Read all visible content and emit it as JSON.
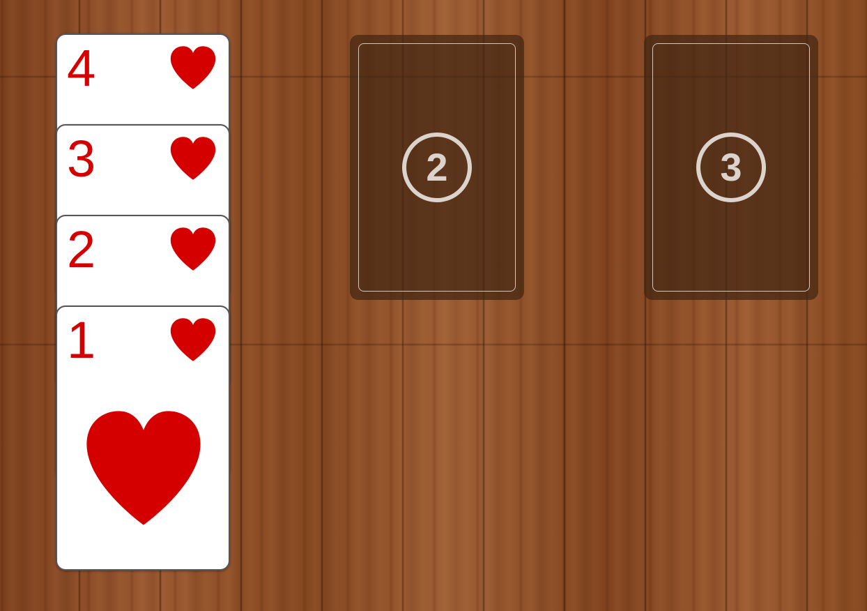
{
  "tableau": {
    "cards": [
      {
        "rank": "4",
        "suit": "hearts-icon"
      },
      {
        "rank": "3",
        "suit": "hearts-icon"
      },
      {
        "rank": "2",
        "suit": "hearts-icon"
      },
      {
        "rank": "1",
        "suit": "hearts-icon"
      }
    ]
  },
  "foundations": [
    {
      "label": "2"
    },
    {
      "label": "3"
    }
  ],
  "colors": {
    "suit_red": "#d40000",
    "card_face": "#ffffff",
    "slot_fill": "#412612",
    "slot_badge": "#dcd3cc"
  }
}
